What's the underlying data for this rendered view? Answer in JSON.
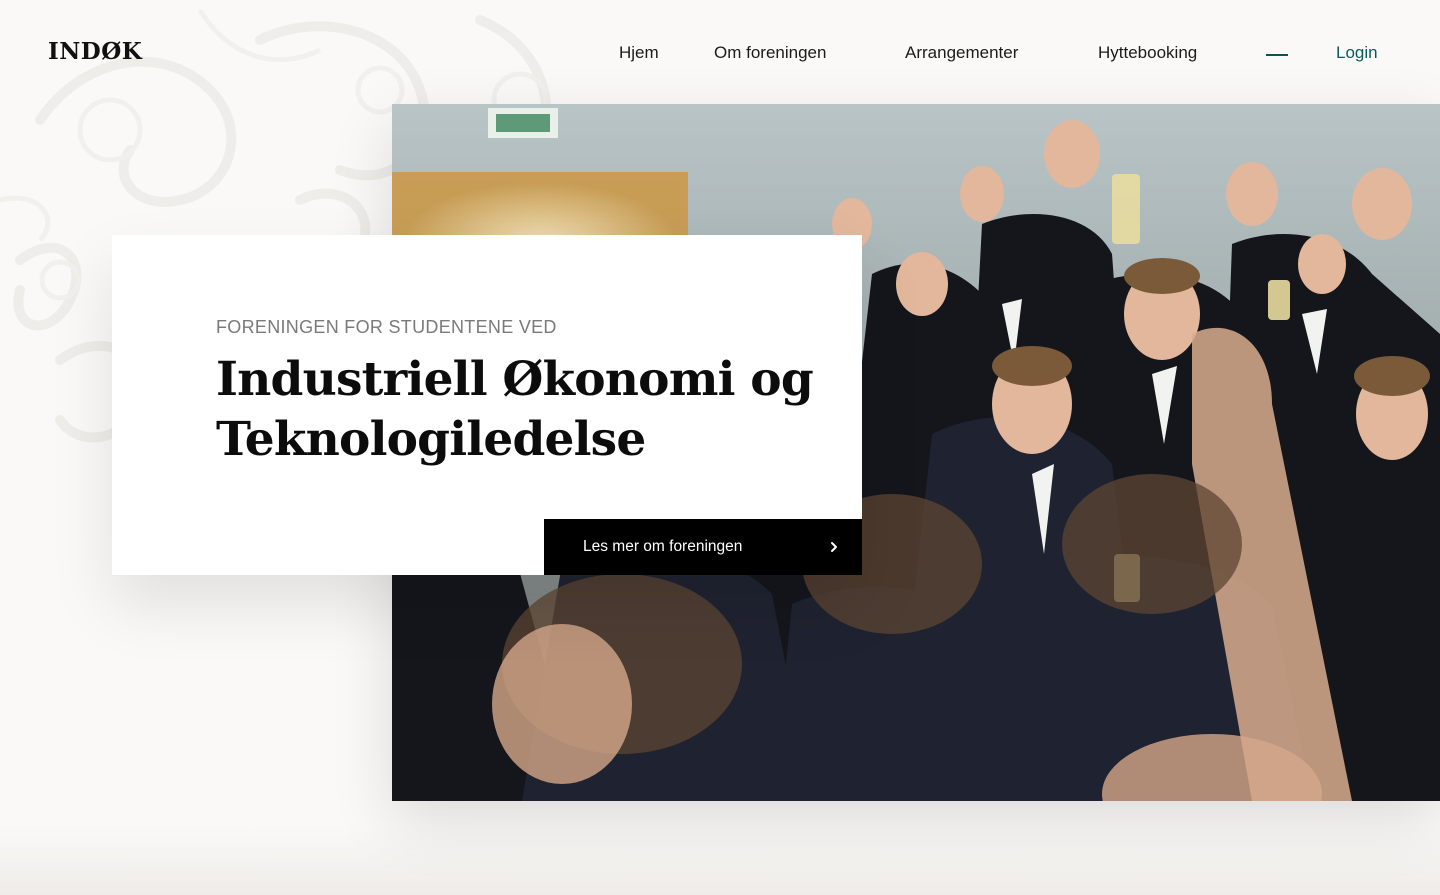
{
  "header": {
    "logo": "INDØK",
    "nav": [
      {
        "label": "Hjem"
      },
      {
        "label": "Om foreningen"
      },
      {
        "label": "Arrangementer"
      },
      {
        "label": "Hyttebooking"
      }
    ],
    "login_label": "Login"
  },
  "hero": {
    "kicker": "FORENINGEN FOR STUDENTENE VED",
    "title_line1": "Industriell Økonomi og",
    "title_line2": "Teknologiledelse",
    "cta_label": "Les mer om foreningen",
    "cta_icon": "chevron-right-icon",
    "image": "photo of students in formal wear cheering with raised glasses"
  },
  "colors": {
    "accent": "#0b5a61",
    "background": "#faf9f7",
    "cta_background": "#000000"
  }
}
